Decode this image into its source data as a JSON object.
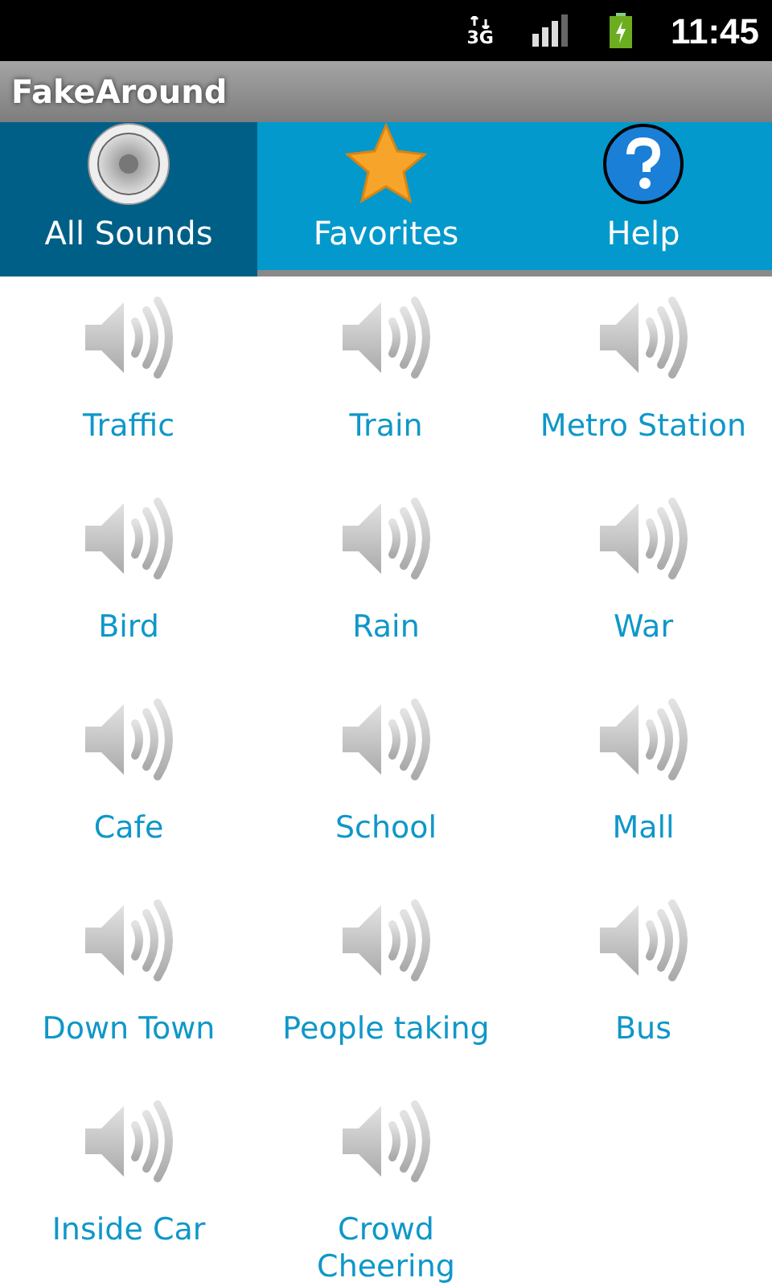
{
  "status_bar": {
    "network_type": "3G",
    "time": "11:45"
  },
  "app_title": "FakeAround",
  "tabs": [
    {
      "label": "All Sounds",
      "kind": "speaker",
      "selected": true
    },
    {
      "label": "Favorites",
      "kind": "star",
      "selected": false
    },
    {
      "label": "Help",
      "kind": "help",
      "selected": false
    }
  ],
  "sounds": [
    {
      "label": "Traffic"
    },
    {
      "label": "Train"
    },
    {
      "label": "Metro Station"
    },
    {
      "label": "Bird"
    },
    {
      "label": "Rain"
    },
    {
      "label": "War"
    },
    {
      "label": "Cafe"
    },
    {
      "label": "School"
    },
    {
      "label": "Mall"
    },
    {
      "label": "Down Town"
    },
    {
      "label": "People taking"
    },
    {
      "label": "Bus"
    },
    {
      "label": "Inside Car"
    },
    {
      "label": "Crowd Cheering"
    }
  ]
}
